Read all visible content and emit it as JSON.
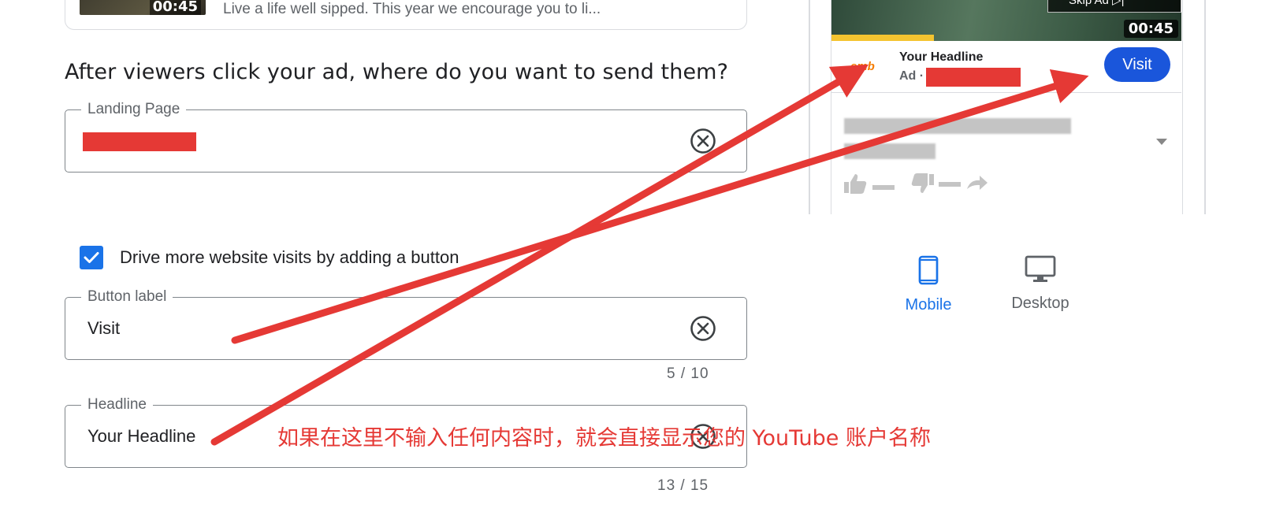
{
  "top_card": {
    "thumb_time": "00:45",
    "description": "Live a life well sipped. This year we encourage you to li..."
  },
  "question": "After viewers click your ad, where do you want to send them?",
  "landing_page": {
    "label": "Landing Page",
    "value": ""
  },
  "checkbox": {
    "label": "Drive more website visits by adding a button",
    "checked": true
  },
  "button_label_field": {
    "label": "Button label",
    "value": "Visit",
    "counter": "5 / 10"
  },
  "headline_field": {
    "label": "Headline",
    "value": "Your Headline",
    "counter": "13 / 15"
  },
  "preview": {
    "skip_text": "Skip Ad ▷|",
    "video_time": "00:45",
    "brand": "emb",
    "headline": "Your Headline",
    "ad_prefix": "Ad ·",
    "visit_button": "Visit"
  },
  "devices": {
    "mobile": "Mobile",
    "desktop": "Desktop",
    "selected": "mobile"
  },
  "annotation": "如果在这里不输入任何内容时，就会直接显示您的 YouTube 账户名称",
  "colors": {
    "accent_blue": "#1a73e8",
    "annotation_red": "#e53935",
    "visit_blue": "#1a56db",
    "progress_yellow": "#f4c430"
  }
}
